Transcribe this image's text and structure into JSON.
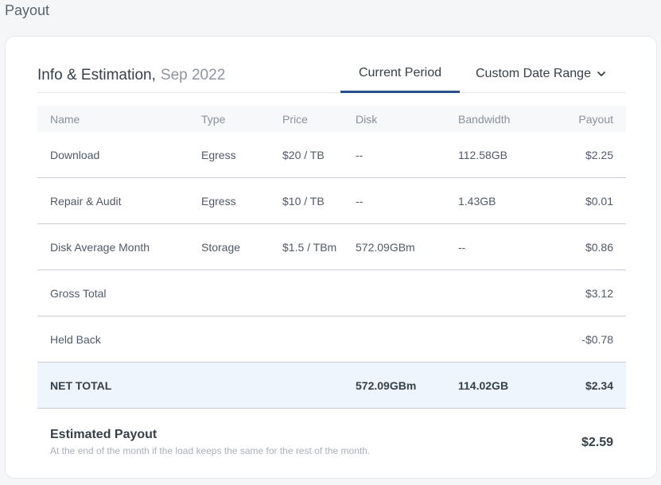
{
  "page": {
    "title": "Payout"
  },
  "card": {
    "title": "Info & Estimation,",
    "month": "Sep 2022",
    "tabs": {
      "current": "Current Period",
      "custom": "Custom Date Range"
    }
  },
  "table": {
    "headers": {
      "name": "Name",
      "type": "Type",
      "price": "Price",
      "disk": "Disk",
      "bandwidth": "Bandwidth",
      "payout": "Payout"
    },
    "rows": [
      {
        "name": "Download",
        "type": "Egress",
        "price": "$20 / TB",
        "disk": "--",
        "bandwidth": "112.58GB",
        "payout": "$2.25"
      },
      {
        "name": "Repair & Audit",
        "type": "Egress",
        "price": "$10 / TB",
        "disk": "--",
        "bandwidth": "1.43GB",
        "payout": "$0.01"
      },
      {
        "name": "Disk Average Month",
        "type": "Storage",
        "price": "$1.5 / TBm",
        "disk": "572.09GBm",
        "bandwidth": "--",
        "payout": "$0.86"
      },
      {
        "name": "Gross Total",
        "payout": "$3.12"
      },
      {
        "name": "Held Back",
        "payout": "-$0.78"
      }
    ],
    "net": {
      "name": "NET TOTAL",
      "disk": "572.09GBm",
      "bandwidth": "114.02GB",
      "payout": "$2.34"
    }
  },
  "estimated": {
    "title": "Estimated Payout",
    "subtitle": "At the end of the month if the load keeps the same for the rest of the month.",
    "value": "$2.59"
  }
}
